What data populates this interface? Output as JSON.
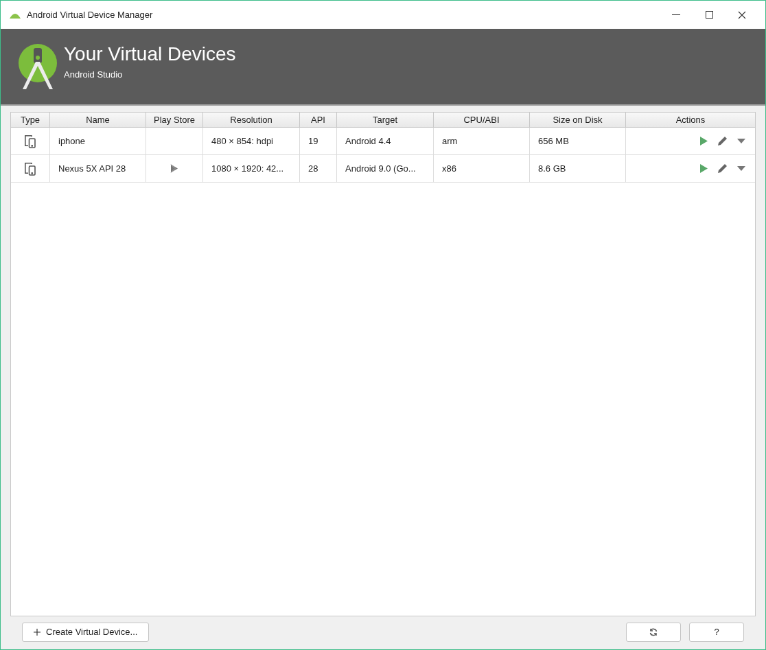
{
  "window": {
    "title": "Android Virtual Device Manager"
  },
  "header": {
    "title": "Your Virtual Devices",
    "subtitle": "Android Studio"
  },
  "table": {
    "columns": [
      "Type",
      "Name",
      "Play Store",
      "Resolution",
      "API",
      "Target",
      "CPU/ABI",
      "Size on Disk",
      "Actions"
    ],
    "rows": [
      {
        "name": "iphone",
        "play_store": false,
        "resolution": "480 × 854: hdpi",
        "api": "19",
        "target": "Android 4.4",
        "cpu": "arm",
        "size": "656 MB"
      },
      {
        "name": "Nexus 5X API 28",
        "play_store": true,
        "resolution": "1080 × 1920: 42...",
        "api": "28",
        "target": "Android 9.0 (Go...",
        "cpu": "x86",
        "size": "8.6 GB"
      }
    ]
  },
  "footer": {
    "create_button": "Create Virtual Device...",
    "help_button": "?"
  }
}
